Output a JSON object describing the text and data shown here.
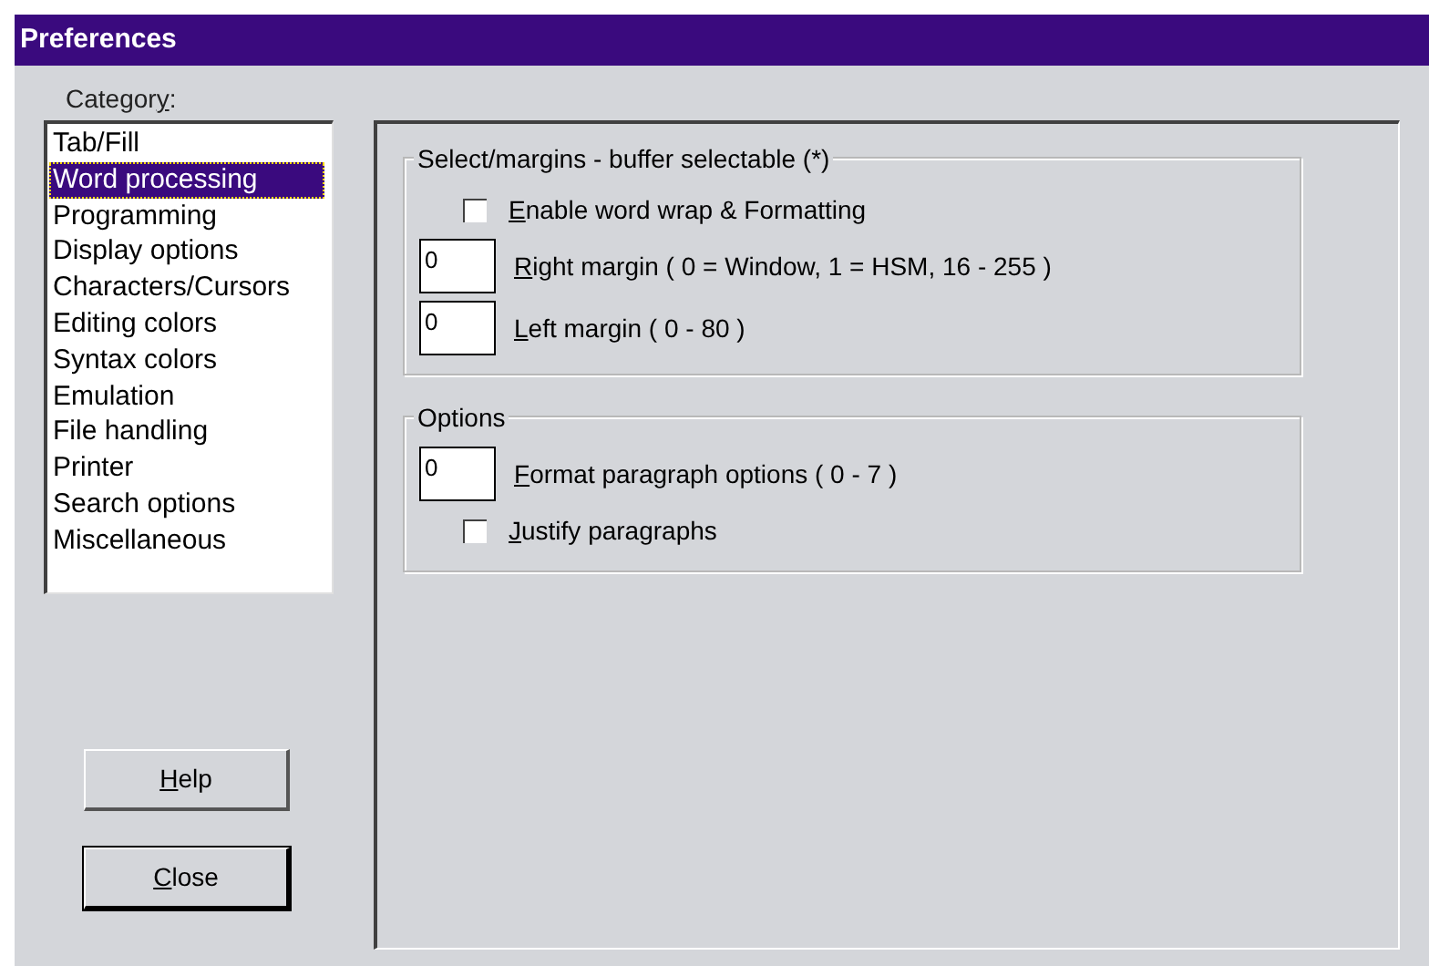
{
  "window": {
    "title": "Preferences"
  },
  "category": {
    "label": "Category:",
    "items": [
      {
        "label": "Tab/Fill",
        "selected": false
      },
      {
        "label": "Word processing",
        "selected": true
      },
      {
        "label": "Programming",
        "selected": false
      },
      {
        "label": "Display options",
        "selected": false
      },
      {
        "label": "Characters/Cursors",
        "selected": false
      },
      {
        "label": "Editing colors",
        "selected": false
      },
      {
        "label": "Syntax colors",
        "selected": false
      },
      {
        "label": "Emulation",
        "selected": false
      },
      {
        "label": "File handling",
        "selected": false
      },
      {
        "label": "Printer",
        "selected": false
      },
      {
        "label": "Search options",
        "selected": false
      },
      {
        "label": "Miscellaneous",
        "selected": false
      }
    ]
  },
  "groups": [
    {
      "title": "Select/margins  -  buffer selectable (*)",
      "rows": [
        {
          "kind": "checkbox",
          "label": "Enable word wrap & Formatting",
          "checked": false
        },
        {
          "kind": "number",
          "value": "0",
          "label": "Right margin ( 0 = Window,  1 = HSM,  16 - 255 )"
        },
        {
          "kind": "number",
          "value": "0",
          "label": "Left margin ( 0 - 80 )"
        }
      ]
    },
    {
      "title": "Options",
      "rows": [
        {
          "kind": "number",
          "value": "0",
          "label": "Format paragraph options ( 0 - 7 )"
        },
        {
          "kind": "checkbox",
          "label": "Justify paragraphs",
          "checked": false
        }
      ]
    }
  ],
  "buttons": [
    {
      "label": "Help",
      "default": false
    },
    {
      "label": "Close",
      "default": true
    }
  ]
}
